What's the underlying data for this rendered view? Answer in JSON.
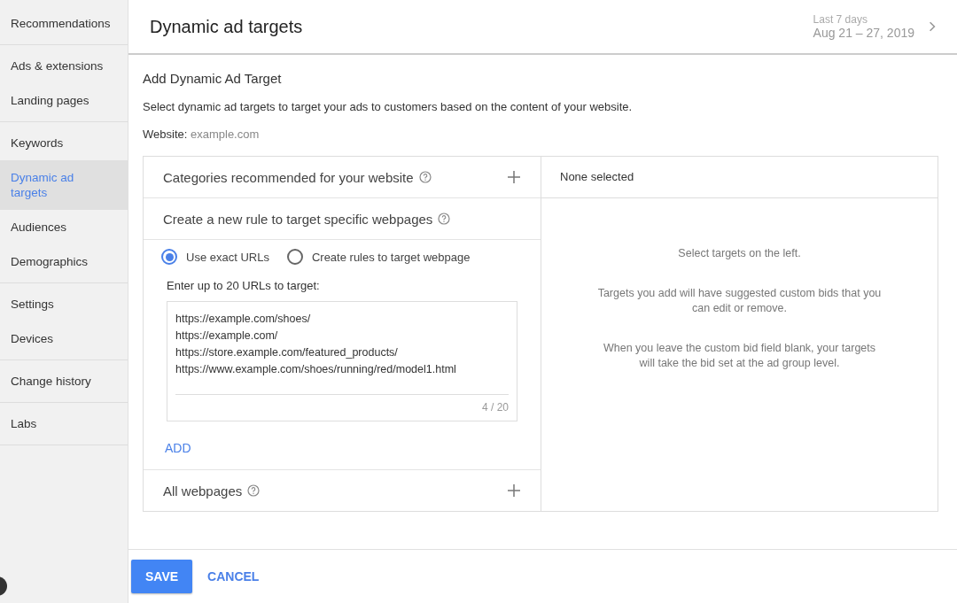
{
  "sidebar": {
    "groups": [
      [
        {
          "label": "Recommendations",
          "selected": false
        }
      ],
      [
        {
          "label": "Ads & extensions",
          "selected": false
        },
        {
          "label": "Landing pages",
          "selected": false
        }
      ],
      [
        {
          "label": "Keywords",
          "selected": false
        },
        {
          "label": "Dynamic ad targets",
          "selected": true
        },
        {
          "label": "Audiences",
          "selected": false
        },
        {
          "label": "Demographics",
          "selected": false
        }
      ],
      [
        {
          "label": "Settings",
          "selected": false
        },
        {
          "label": "Devices",
          "selected": false
        }
      ],
      [
        {
          "label": "Change history",
          "selected": false
        }
      ],
      [
        {
          "label": "Labs",
          "selected": false
        }
      ]
    ]
  },
  "header": {
    "title": "Dynamic ad targets",
    "date_range": {
      "label": "Last 7 days",
      "value": "Aug 21 – 27, 2019"
    }
  },
  "form": {
    "title": "Add Dynamic Ad Target",
    "description": "Select dynamic ad targets to target your ads to customers based on the content of your website.",
    "website_label": "Website:",
    "website": "example.com"
  },
  "left_panel": {
    "categories": {
      "label": "Categories recommended for your website"
    },
    "rule": {
      "label": "Create a new rule to target specific webpages"
    },
    "options": [
      {
        "label": "Use exact URLs",
        "selected": true
      },
      {
        "label": "Create rules to target webpage",
        "selected": false
      }
    ],
    "urls_label": "Enter up to 20 URLs to target:",
    "urls": [
      "https://example.com/shoes/",
      "https://example.com/",
      "https://store.example.com/featured_products/",
      "https://www.example.com/shoes/running/red/model1.html"
    ],
    "counter": "4 / 20",
    "add": "ADD",
    "all_webpages": {
      "label": "All webpages"
    }
  },
  "right_panel": {
    "header": "None selected",
    "messages": [
      "Select targets on the left.",
      "Targets you add will have suggested custom bids that you can edit or remove.",
      "When you leave the custom bid field blank, your targets will take the bid set at the ad group level."
    ]
  },
  "buttons": {
    "save": "SAVE",
    "cancel": "CANCEL"
  }
}
